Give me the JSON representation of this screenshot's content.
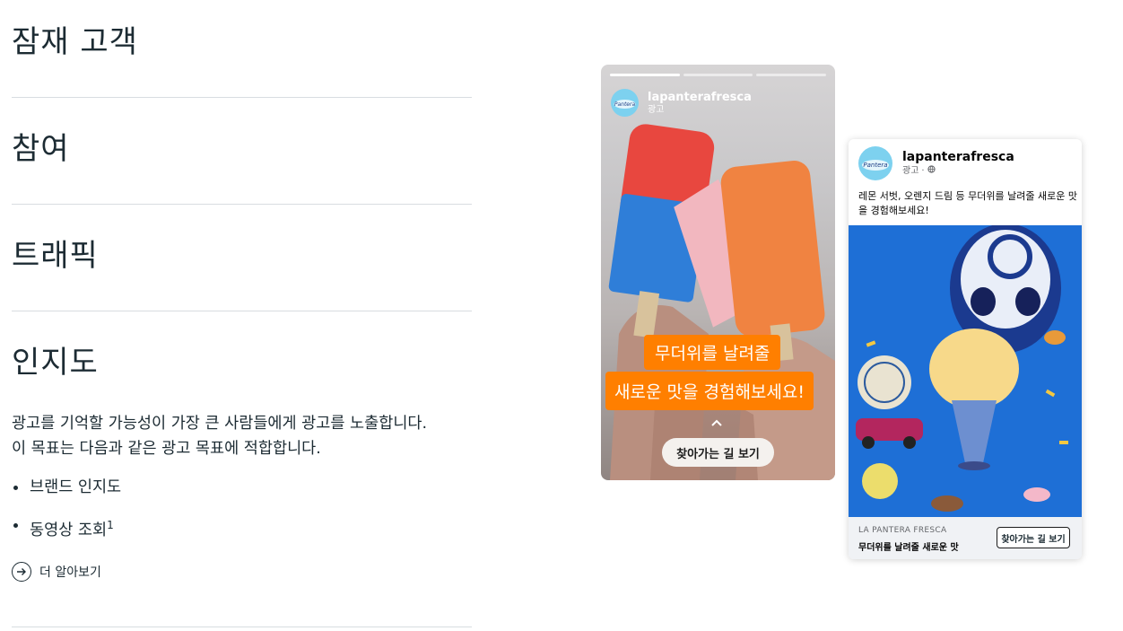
{
  "accordion": {
    "items": [
      {
        "title": "잠재 고객"
      },
      {
        "title": "참여"
      },
      {
        "title": "트래픽"
      },
      {
        "title": "인지도"
      }
    ],
    "expanded": {
      "description_line1": "광고를 기억할 가능성이 가장 큰 사람들에게 광고를 노출합니다.",
      "description_line2": "이 목표는 다음과 같은 광고 목표에 적합합니다.",
      "bullets": [
        "브랜드 인지도",
        "동영상 조회"
      ],
      "footnote_mark": "1",
      "learn_more": "더 알아보기"
    }
  },
  "story_ad": {
    "account": "lapanterafresca",
    "sponsored": "광고",
    "overlay_line1": "무더위를 날려줄",
    "overlay_line2": "새로운 맛을 경험해보세요!",
    "cta_button": "찾아가는 길 보기",
    "progress_segments": 3,
    "active_segment": 1
  },
  "feed_ad": {
    "account": "lapanterafresca",
    "sponsored": "광고",
    "primary_text": "레몬 서벗, 오렌지 드림 등 무더위를 날려줄 새로운 맛을 경험해보세요!",
    "brand_caption": "LA PANTERA FRESCA",
    "headline": "무더위를 날려줄 새로운 맛",
    "cta_button": "찾아가는 길 보기"
  },
  "colors": {
    "text": "#1c2b33",
    "divider": "#d8dde1",
    "cta_orange": "#ff7f00",
    "avatar_blue": "#7dd1ef",
    "feed_image_blue": "#1c74d8"
  },
  "icons": [
    "arrow-right-circle-icon",
    "chevron-up-icon",
    "globe-icon",
    "brand-logo-icon"
  ]
}
